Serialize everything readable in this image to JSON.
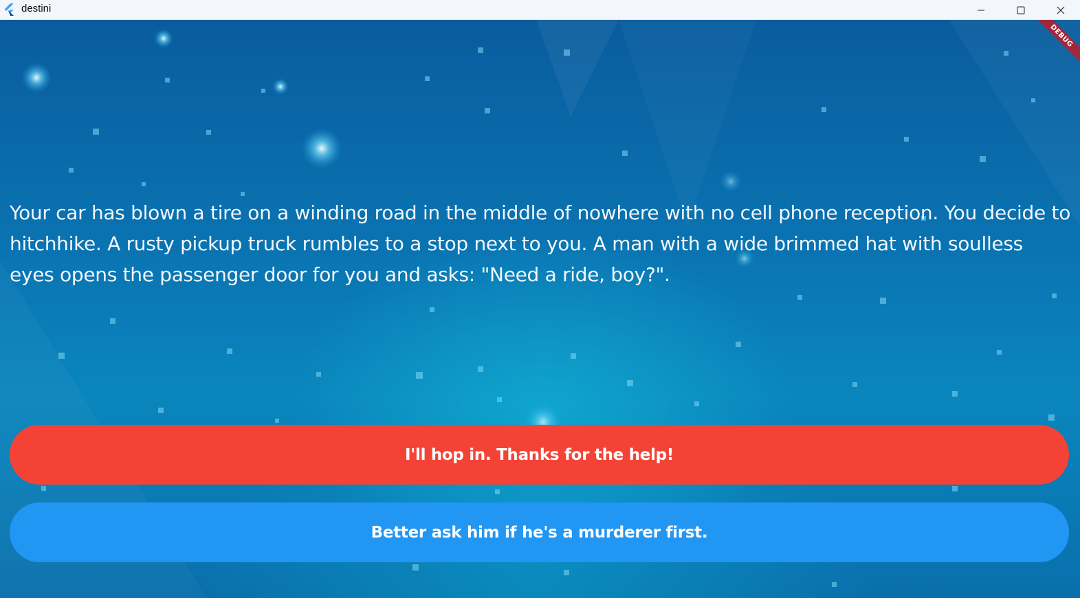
{
  "window": {
    "title": "destini",
    "icon": "flutter-logo-icon"
  },
  "controls": {
    "minimize_icon": "minimize-icon",
    "maximize_icon": "maximize-icon",
    "close_icon": "close-icon"
  },
  "debug_banner": {
    "label": "DEBUG",
    "color": "#a3273a"
  },
  "story": {
    "text": "Your car has blown a tire on a winding road in the middle of nowhere with no cell phone reception. You decide to hitchhike. A rusty pickup truck rumbles to a stop next to you. A man with a wide brimmed hat with soulless eyes opens the passenger door for you and asks: \"Need a ride, boy?\"."
  },
  "choices": [
    {
      "label": "I'll hop in. Thanks for the help!",
      "color": "#f44336"
    },
    {
      "label": "Better ask him if he's a murderer first.",
      "color": "#2196f3"
    }
  ],
  "colors": {
    "titlebar_bg": "#f3f6fa",
    "story_text": "#f2f7fb"
  }
}
